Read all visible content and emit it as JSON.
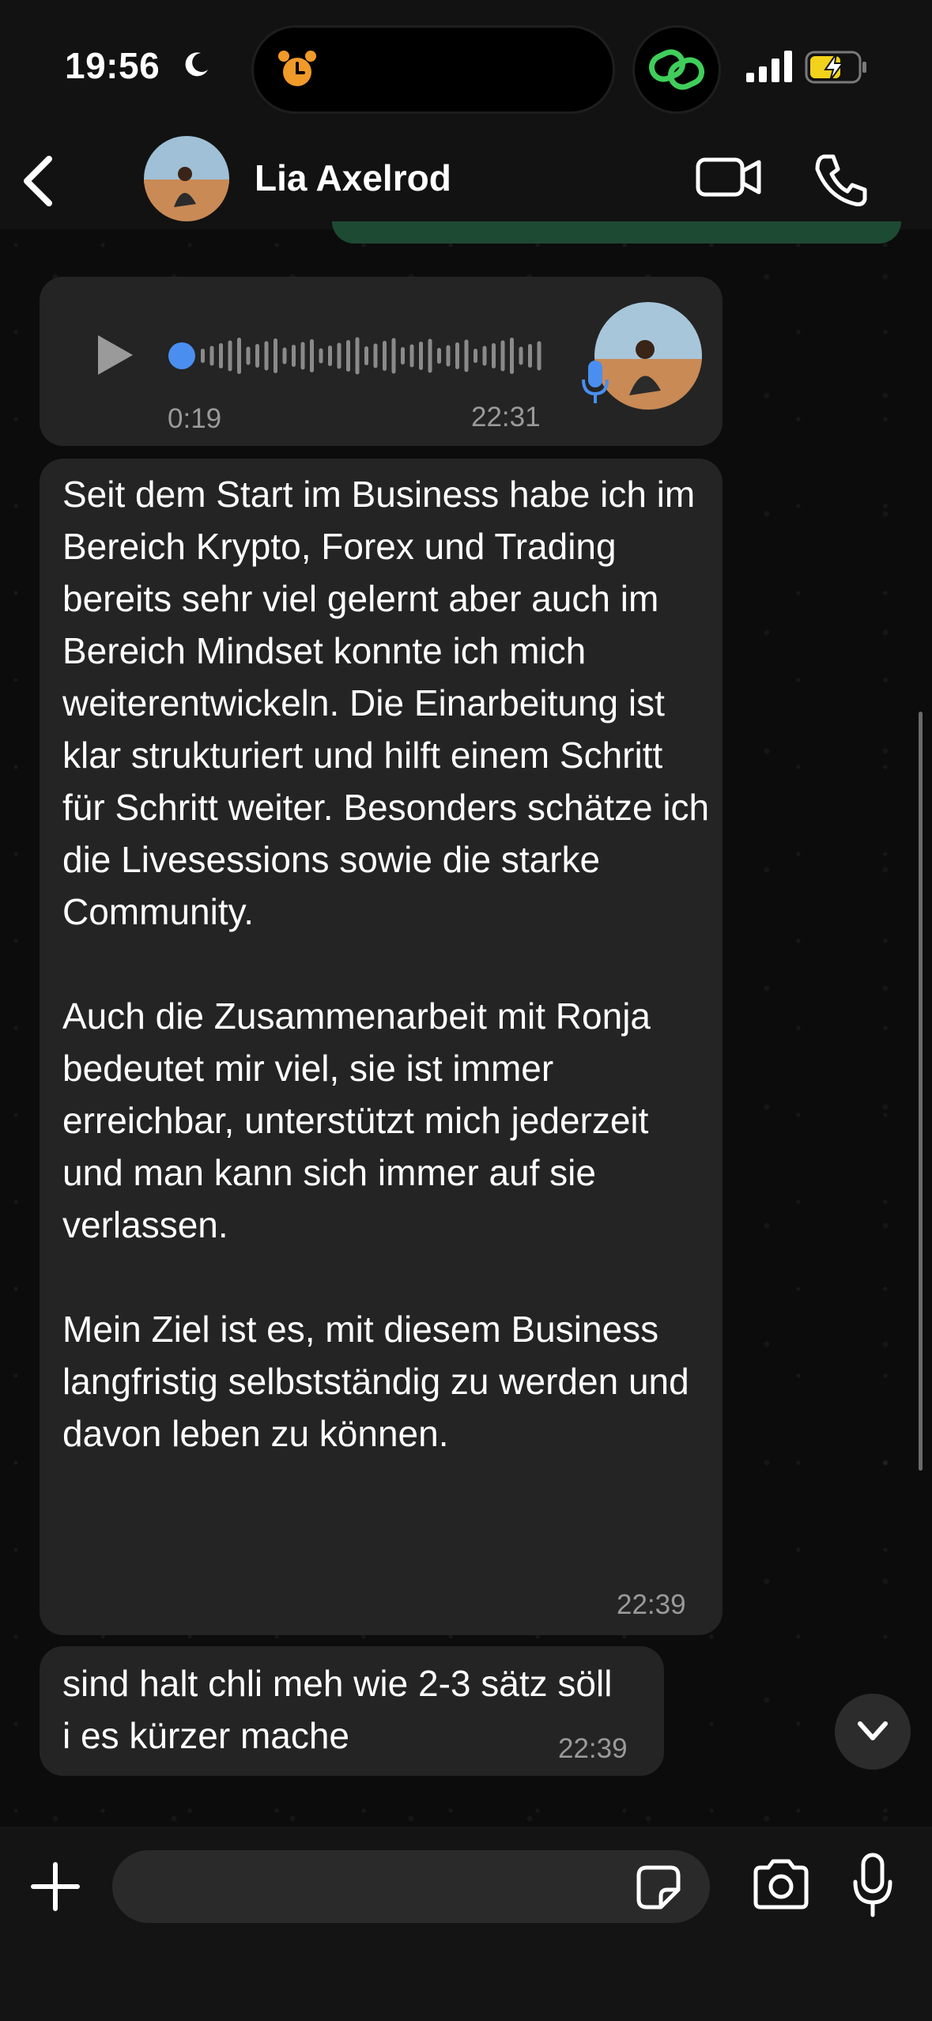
{
  "status_bar": {
    "time": "19:56"
  },
  "header": {
    "contact_name": "Lia Axelrod"
  },
  "messages": {
    "voice": {
      "duration": "0:19",
      "time": "22:31"
    },
    "long_text": {
      "text": "Seit dem Start im Business habe ich im Bereich Krypto, Forex und Trading bereits sehr viel gelernt aber auch im Bereich Mindset konnte ich mich weiterentwickeln. Die Einarbeitung ist klar strukturiert und hilft einem Schritt für Schritt weiter. Besonders schätze ich die Livesessions sowie die starke Community.\n\nAuch die Zusammenarbeit mit Ronja bedeutet mir viel, sie ist immer erreichbar, unterstützt mich jederzeit und man kann sich immer auf sie verlassen.\n\nMein Ziel ist es, mit diesem Business langfristig selbstständig zu werden und davon leben zu können.",
      "time": "22:39"
    },
    "short_text": {
      "text": "sind halt chli meh wie 2-3 sätz söll i es kürzer mache",
      "time": "22:39"
    }
  },
  "composer": {
    "placeholder": ""
  },
  "colors": {
    "bubble": "#242424",
    "accent_voice": "#4a8ff0",
    "battery": "#f3d21b",
    "link_green": "#3fce5b"
  }
}
